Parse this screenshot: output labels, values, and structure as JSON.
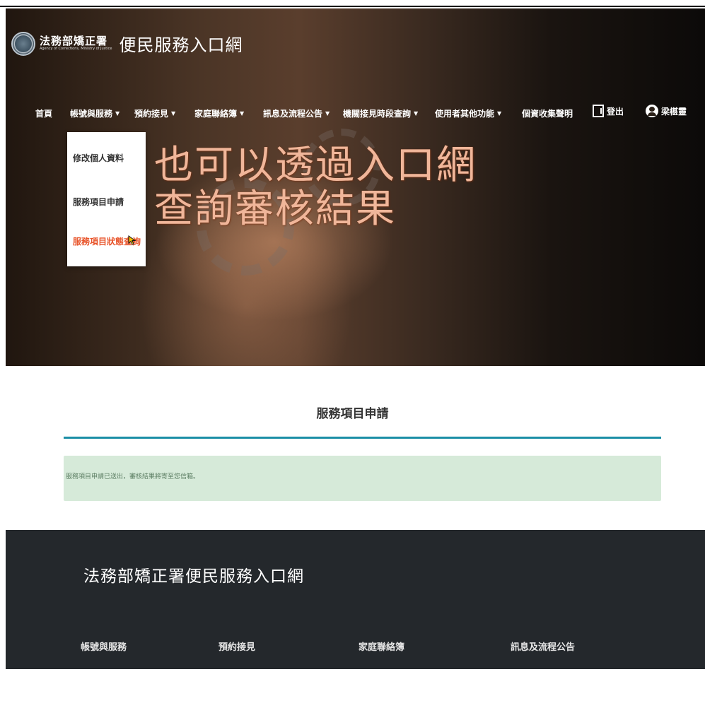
{
  "logo": {
    "org_name": "法務部矯正署",
    "org_english": "Agency of Corrections, Ministry of Justice",
    "portal_name": "便民服務入口網"
  },
  "nav": {
    "home": "首頁",
    "account_services": "帳號與服務",
    "visit_booking": "預約接見",
    "family_contact": "家庭聯絡簿",
    "news": "訊息及流程公告",
    "agency_visit_times": "機關接見時段查詢",
    "other_functions": "使用者其他功能",
    "privacy": "個資收集聲明",
    "logout": "登出",
    "user_name": "梁椹靈",
    "caret": "▼"
  },
  "dropdown": {
    "items": [
      "修改個人資料",
      "服務項目申請",
      "服務項目狀態查詢"
    ],
    "active_index": 2
  },
  "hero": {
    "line1": "也可以透過入口網",
    "line2": "查詢審核結果"
  },
  "main": {
    "title": "服務項目申請",
    "alert": "服務項目申請已送出，審核結果將寄至您信箱。"
  },
  "footer": {
    "title": "法務部矯正署便民服務入口網",
    "links": [
      "帳號與服務",
      "預約接見",
      "家庭聯絡簿",
      "訊息及流程公告"
    ]
  },
  "colors": {
    "accent_rule": "#1b8ea6",
    "alert_bg": "#d6ead9",
    "footer_bg": "#24282c",
    "dropdown_active": "#e8542a",
    "hero_text": "#f0b69a"
  }
}
